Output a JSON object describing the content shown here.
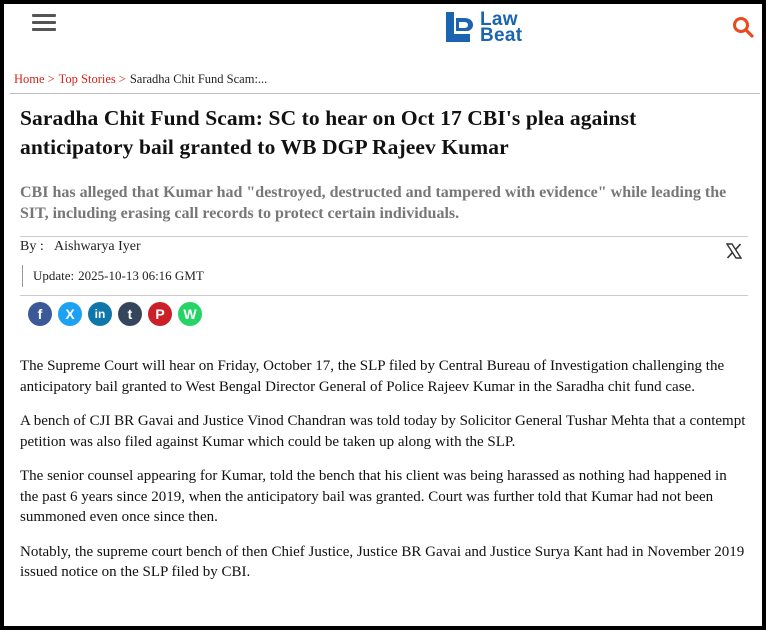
{
  "header": {
    "logo_line1": "Law",
    "logo_line2": "Beat",
    "brand_color": "#1a64b2",
    "accent_color": "#d0261a"
  },
  "breadcrumb": {
    "home": "Home",
    "section": "Top Stories",
    "current": "Saradha Chit Fund Scam:...",
    "separator": ">"
  },
  "article": {
    "title": "Saradha Chit Fund Scam: SC to hear on Oct 17 CBI's plea against anticipatory bail granted to WB DGP Rajeev Kumar",
    "summary": "CBI has alleged that Kumar had \"destroyed, destructed and tampered with evidence\" while leading the SIT, including erasing call records to protect certain individuals.",
    "by_label": "By :",
    "author": "Aishwarya Iyer",
    "update_label": "Update:",
    "update_time": "2025-10-13 06:16 GMT",
    "paragraphs": [
      "The Supreme Court will hear on Friday, October 17, the SLP filed by Central Bureau of Investigation challenging the anticipatory bail granted to West Bengal Director General of Police Rajeev Kumar in the Saradha chit fund case.",
      "A bench of CJI BR Gavai and Justice Vinod Chandran was told today by Solicitor General Tushar Mehta that a contempt petition was also filed against Kumar which could be taken up along with the SLP.",
      "The senior counsel appearing for Kumar, told the bench that his client was being harassed as nothing had happened in the past 6 years since 2019, when the anticipatory bail was granted. Court was further told that Kumar had not been summoned even once since then.",
      "Notably, the supreme court bench of then Chief Justice, Justice BR Gavai and Justice Surya Kant had in November 2019 issued notice on the SLP filed by CBI."
    ]
  },
  "share": [
    {
      "name": "facebook-icon",
      "glyph": "f",
      "color": "#3b5998"
    },
    {
      "name": "x-twitter-icon",
      "glyph": "X",
      "color": "#1da1f2"
    },
    {
      "name": "linkedin-icon",
      "glyph": "in",
      "color": "#0e76a8"
    },
    {
      "name": "tumblr-icon",
      "glyph": "t",
      "color": "#35465c"
    },
    {
      "name": "pinterest-icon",
      "glyph": "P",
      "color": "#cb2027"
    },
    {
      "name": "whatsapp-icon",
      "glyph": "W",
      "color": "#25d366"
    }
  ]
}
